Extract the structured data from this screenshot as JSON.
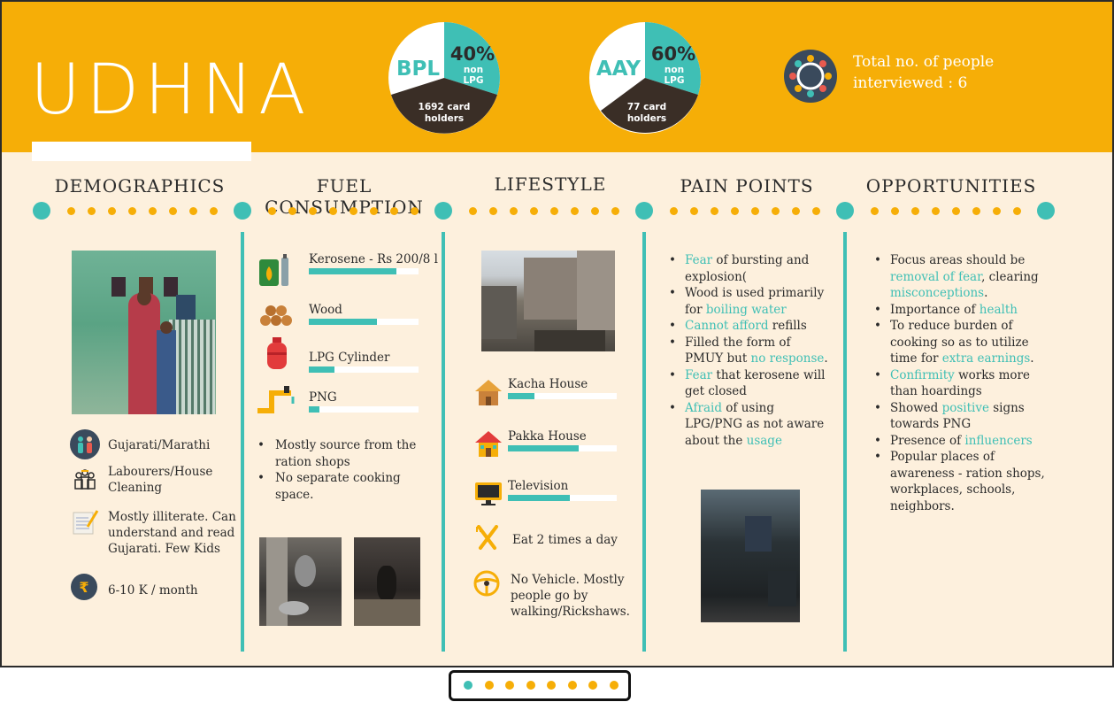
{
  "title": "UDHNA",
  "pies": [
    {
      "left_label": "BPL",
      "pct": "40%",
      "pct_sub": "non LPG",
      "bottom": "1692 card holders",
      "non_lpg_fraction": 0.4
    },
    {
      "left_label": "AAY",
      "pct": "60%",
      "pct_sub": "non LPG",
      "bottom": "77 card holders",
      "non_lpg_fraction": 0.6
    }
  ],
  "total": {
    "line1": "Total no. of people",
    "line2": "interviewed : 6"
  },
  "sections": [
    "DEMOGRAPHICS",
    "FUEL CONSUMPTION",
    "LIFESTYLE",
    "PAIN POINTS",
    "OPPORTUNITIES"
  ],
  "demographics": {
    "language": "Gujarati/Marathi",
    "occupation": [
      "Labourers/House",
      "Cleaning"
    ],
    "literacy": [
      "Mostly illiterate. Can",
      "understand and read",
      "Gujarati. Few Kids"
    ],
    "income": "6-10 K / month"
  },
  "fuel": {
    "items": [
      {
        "label": "Kerosene - Rs 200/8 l",
        "level": 0.8,
        "icon": "kerosene-icon"
      },
      {
        "label": "Wood",
        "level": 0.62,
        "icon": "wood-icon"
      },
      {
        "label": "LPG Cylinder",
        "level": 0.23,
        "icon": "lpg-cylinder-icon"
      },
      {
        "label": "PNG",
        "level": 0.1,
        "icon": "png-pipe-icon"
      }
    ],
    "notes": [
      [
        "Mostly source from the",
        "ration shops"
      ],
      [
        "No separate cooking",
        "space."
      ]
    ]
  },
  "lifestyle": {
    "items": [
      {
        "label": "Kacha House",
        "level": 0.24,
        "icon": "kacha-house-icon"
      },
      {
        "label": "Pakka House",
        "level": 0.65,
        "icon": "pakka-house-icon"
      },
      {
        "label": "Television",
        "level": 0.57,
        "icon": "television-icon"
      }
    ],
    "meals": "Eat 2 times a day",
    "vehicle": [
      "No Vehicle. Mostly",
      "people go by",
      "walking/Rickshaws."
    ]
  },
  "pain_points": [
    [
      {
        "t": "Fear",
        "h": true
      },
      {
        "t": " of bursting and",
        "h": false
      }
    ],
    [
      {
        "t": "explosion(",
        "h": false
      }
    ],
    [
      {
        "t": "Wood is used primarily",
        "h": false
      }
    ],
    [
      {
        "t": "for ",
        "h": false
      },
      {
        "t": "boiling water",
        "h": true
      }
    ],
    [
      {
        "t": "Cannot afford",
        "h": true
      },
      {
        "t": " refills",
        "h": false
      }
    ],
    [
      {
        "t": "Filled the form of",
        "h": false
      }
    ],
    [
      {
        "t": "PMUY but ",
        "h": false
      },
      {
        "t": "no response",
        "h": true
      },
      {
        "t": ".",
        "h": false
      }
    ],
    [
      {
        "t": "Fear",
        "h": true
      },
      {
        "t": " that kerosene will",
        "h": false
      }
    ],
    [
      {
        "t": "get closed",
        "h": false
      }
    ],
    [
      {
        "t": "Afraid",
        "h": true
      },
      {
        "t": " of using",
        "h": false
      }
    ],
    [
      {
        "t": "LPG/PNG as not aware",
        "h": false
      }
    ],
    [
      {
        "t": "about the ",
        "h": false
      },
      {
        "t": "usage",
        "h": true
      }
    ]
  ],
  "pain_bullet_rows": [
    0,
    2,
    4,
    5,
    7,
    9
  ],
  "opportunities": [
    [
      {
        "t": "Focus areas should be",
        "h": false
      }
    ],
    [
      {
        "t": "removal of fear",
        "h": true
      },
      {
        "t": ", clearing",
        "h": false
      }
    ],
    [
      {
        "t": "misconceptions",
        "h": true
      },
      {
        "t": ".",
        "h": false
      }
    ],
    [
      {
        "t": "Importance of ",
        "h": false
      },
      {
        "t": "health",
        "h": true
      }
    ],
    [
      {
        "t": "To reduce burden of",
        "h": false
      }
    ],
    [
      {
        "t": "cooking so as to utilize",
        "h": false
      }
    ],
    [
      {
        "t": "time for ",
        "h": false
      },
      {
        "t": "extra earnings",
        "h": true
      },
      {
        "t": ".",
        "h": false
      }
    ],
    [
      {
        "t": "Confirmity",
        "h": true
      },
      {
        "t": " works more",
        "h": false
      }
    ],
    [
      {
        "t": "than hoardings",
        "h": false
      }
    ],
    [
      {
        "t": "Showed ",
        "h": false
      },
      {
        "t": "positive",
        "h": true
      },
      {
        "t": " signs",
        "h": false
      }
    ],
    [
      {
        "t": "towards PNG",
        "h": false
      }
    ],
    [
      {
        "t": "Presence of ",
        "h": false
      },
      {
        "t": "influencers",
        "h": true
      }
    ],
    [
      {
        "t": "Popular places of",
        "h": false
      }
    ],
    [
      {
        "t": "awareness - ration shops,",
        "h": false
      }
    ],
    [
      {
        "t": "workplaces, schools,",
        "h": false
      }
    ],
    [
      {
        "t": "neighbors.",
        "h": false
      }
    ]
  ],
  "opp_bullet_rows": [
    0,
    3,
    4,
    7,
    9,
    11,
    12
  ],
  "colors": {
    "accent": "#3fbfb5",
    "header": "#f6ae07",
    "dark": "#3a2e26",
    "bg": "#fdf0dd"
  },
  "pager": {
    "total": 8,
    "active": 0
  }
}
